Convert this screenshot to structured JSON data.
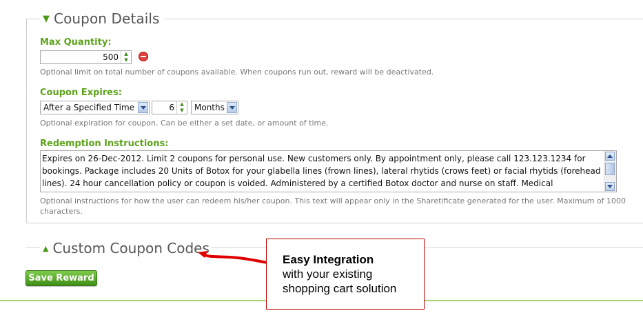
{
  "section": {
    "title": "Coupon Details",
    "max_quantity": {
      "label": "Max Quantity:",
      "value": "500",
      "help": "Optional limit on total number of coupons available. When coupons run out, reward will be deactivated."
    },
    "coupon_expires": {
      "label": "Coupon Expires:",
      "mode": "After a Specified Time",
      "amount": "6",
      "unit": "Months",
      "help": "Optional expiration for coupon. Can be either a set date, or amount of time."
    },
    "redemption": {
      "label": "Redemption Instructions:",
      "text": "Expires on 26-Dec-2012. Limit 2 coupons for personal use. New customers only. By appointment only, please call 123.123.1234 for bookings. Package includes 20 Units of Botox for your glabella lines (frown lines), lateral rhytids (crows feet) or facial rhytids (forehead lines). 24 hour cancellation policy or coupon is voided. Administered by a certified Botox doctor and nurse on staff. Medical consultation included. Not valid with other offers. Not valid toward other treatments or products.",
      "help": "Optional instructions for how the user can redeem his/her coupon. This text will appear only in the Sharetificate generated for the user. Maximum of 1000 characters."
    }
  },
  "custom_codes": {
    "title": "Custom Coupon Codes"
  },
  "save_button": "Save Reward",
  "callout": {
    "heading": "Easy Integration",
    "line2": "with your existing",
    "line3": "shopping cart solution"
  },
  "colors": {
    "accent_green": "#5da31c",
    "callout_red": "#c00000"
  }
}
